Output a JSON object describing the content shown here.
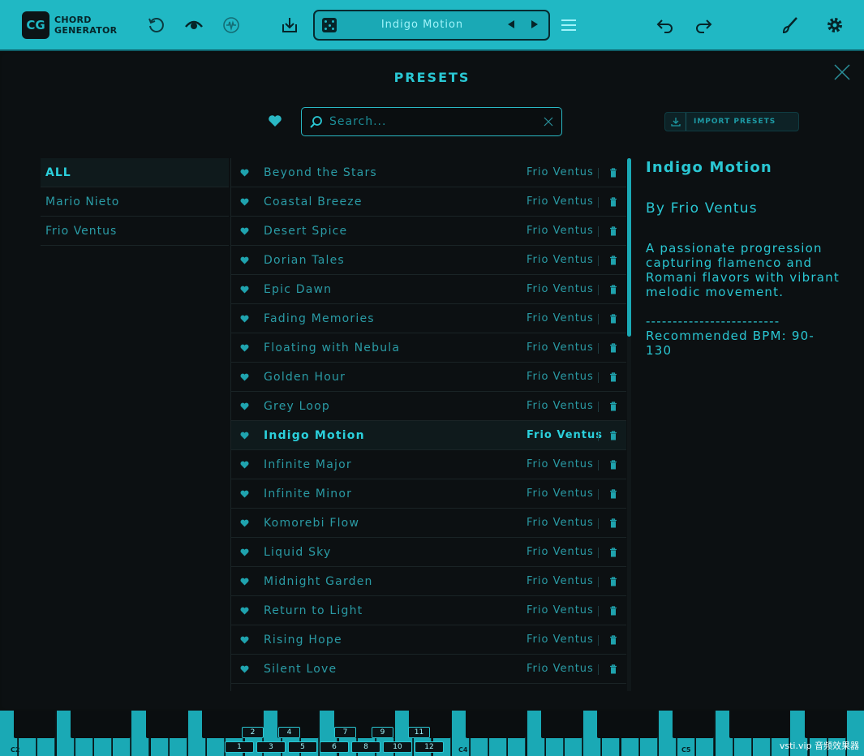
{
  "app": {
    "logo_mark": "CG",
    "logo_line1": "CHORD",
    "logo_line2": "GENERATOR",
    "current_preset": "Indigo Motion",
    "accent_color": "#20b8c4",
    "background_color": "#0c1012"
  },
  "toolbar": {
    "icons": [
      "refresh-icon",
      "humanize-icon",
      "audition-icon",
      "export-icon",
      "dice-icon",
      "prev-preset-icon",
      "next-preset-icon",
      "menu-icon",
      "undo-icon",
      "redo-icon",
      "brush-icon",
      "settings-icon"
    ]
  },
  "presets_panel": {
    "title": "PRESETS",
    "search_placeholder": "Search...",
    "import_label": "IMPORT PRESETS",
    "authors": [
      "ALL",
      "Mario Nieto",
      "Frio Ventus"
    ],
    "selected_author": "ALL",
    "list": [
      {
        "name": "Beyond the Stars",
        "author": "Frio Ventus"
      },
      {
        "name": "Coastal Breeze",
        "author": "Frio Ventus"
      },
      {
        "name": "Desert Spice",
        "author": "Frio Ventus"
      },
      {
        "name": "Dorian Tales",
        "author": "Frio Ventus"
      },
      {
        "name": "Epic Dawn",
        "author": "Frio Ventus"
      },
      {
        "name": "Fading Memories",
        "author": "Frio Ventus"
      },
      {
        "name": "Floating with Nebula",
        "author": "Frio Ventus"
      },
      {
        "name": "Golden Hour",
        "author": "Frio Ventus"
      },
      {
        "name": "Grey Loop",
        "author": "Frio Ventus"
      },
      {
        "name": "Indigo Motion",
        "author": "Frio Ventus",
        "selected": true
      },
      {
        "name": "Infinite Major",
        "author": "Frio Ventus"
      },
      {
        "name": "Infinite Minor",
        "author": "Frio Ventus"
      },
      {
        "name": "Komorebi Flow",
        "author": "Frio Ventus"
      },
      {
        "name": "Liquid Sky",
        "author": "Frio Ventus"
      },
      {
        "name": "Midnight Garden",
        "author": "Frio Ventus"
      },
      {
        "name": "Return to Light",
        "author": "Frio Ventus"
      },
      {
        "name": "Rising Hope",
        "author": "Frio Ventus"
      },
      {
        "name": "Silent Love",
        "author": "Frio Ventus"
      }
    ],
    "detail": {
      "title": "Indigo Motion",
      "author": "By Frio Ventus",
      "description": "A passionate progression capturing flamenco and Romani flavors with vibrant melodic movement.",
      "separator": "-------------------------",
      "bpm": "Recommended BPM: 90-130"
    }
  },
  "keyboard": {
    "octave_labels": [
      "C2",
      "C4",
      "C5"
    ],
    "upper_chord_keys": [
      "2",
      "4",
      "7",
      "9",
      "11"
    ],
    "lower_chord_keys": [
      "1",
      "3",
      "5",
      "6",
      "8",
      "10",
      "12"
    ]
  },
  "watermark": "vsti.vip 音频效果器"
}
